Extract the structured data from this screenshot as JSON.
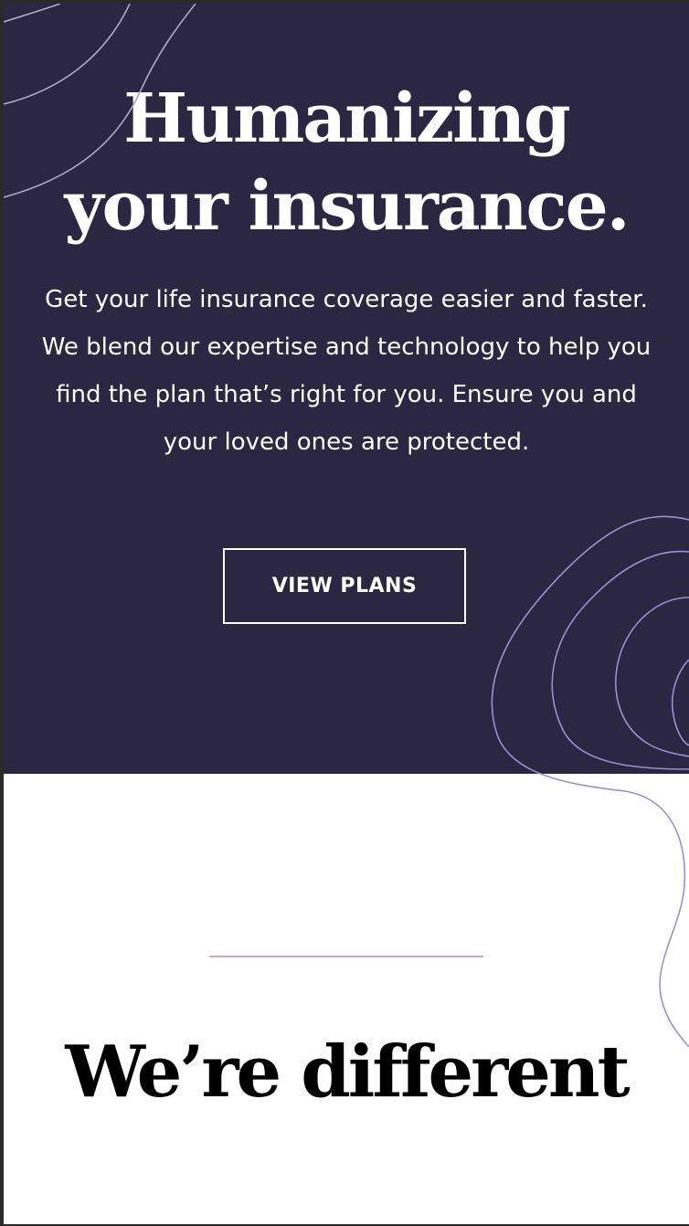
{
  "hero": {
    "title_line1": "Humanizing",
    "title_line2": "your insurance.",
    "description": "Get your life insurance coverage easier and faster. We blend our expertise and technology to help you find the plan that’s right for you. Ensure you and your loved ones are protected.",
    "cta_label": "VIEW PLANS"
  },
  "section": {
    "title": "We’re different"
  },
  "colors": {
    "hero_background": "#2b2642",
    "contour_top": "#a9a9c8",
    "contour_right": "#9a90d0",
    "divider": "#c9a6d6"
  },
  "icons": {
    "top_left_decoration": "topographic-contour-lines",
    "right_decoration": "topographic-contour-lines"
  }
}
